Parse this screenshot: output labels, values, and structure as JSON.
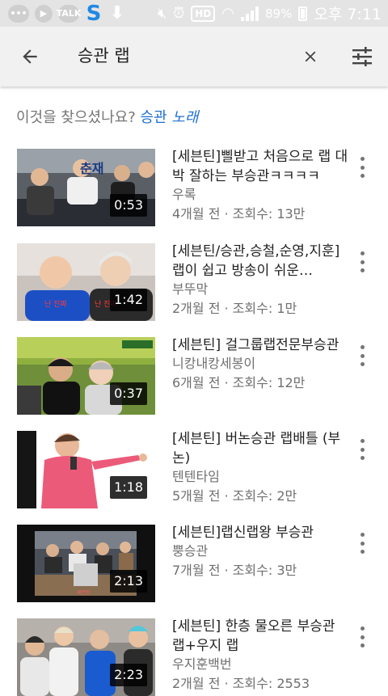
{
  "status_bar": {
    "talk_badge": "TALK",
    "s_badge": "S",
    "hd_badge": "HD",
    "battery_text": "89%",
    "time": "오후 7:11"
  },
  "search": {
    "query": "승관 랩"
  },
  "suggestion": {
    "prefix": "이것을 찾으셨나요?",
    "link_plain": "승관",
    "link_italic": "노래"
  },
  "videos": [
    {
      "title": "[세븐틴]삘받고 처음으로 랩 대박 잘하는 부승관ㅋㅋㅋㅋ",
      "channel": "우록",
      "meta": "4개월 전 · 조회수: 13만",
      "duration": "0:53"
    },
    {
      "title": "[세븐틴/승관,승철,순영,지훈] 랩이 쉽고 방송이 쉬운…",
      "channel": "부뚜막",
      "meta": "2개월 전 · 조회수: 1만",
      "duration": "1:42"
    },
    {
      "title": "[세븐틴] 걸그룹랩전문부승관",
      "channel": "니캉내캉세봉이",
      "meta": "6개월 전 · 조회수: 12만",
      "duration": "0:37"
    },
    {
      "title": "[세븐틴] 버논승관 랩배틀 (부논)",
      "channel": "텐텐타임",
      "meta": "5개월 전 · 조회수: 2만",
      "duration": "1:18"
    },
    {
      "title": "[세븐틴]랩신랩왕 부승관",
      "channel": "뿡승관",
      "meta": "7개월 전 · 조회수: 3만",
      "duration": "2:13"
    },
    {
      "title": "[세븐틴] 한층 물오른 부승관 랩+우지 랩",
      "channel": "우지훈백번",
      "meta": "2개월 전 · 조회수: 2553",
      "duration": "2:23"
    }
  ]
}
